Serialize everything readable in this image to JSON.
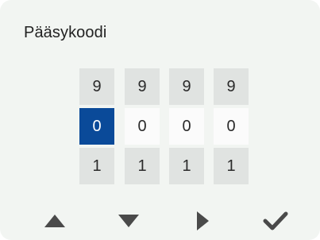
{
  "header": {
    "title": "Pääsykoodi"
  },
  "code": {
    "columns": [
      {
        "prev": "9",
        "current": "0",
        "next": "1",
        "selected": true
      },
      {
        "prev": "9",
        "current": "0",
        "next": "1",
        "selected": false
      },
      {
        "prev": "9",
        "current": "0",
        "next": "1",
        "selected": false
      },
      {
        "prev": "9",
        "current": "0",
        "next": "1",
        "selected": false
      }
    ]
  },
  "nav": {
    "up": "up-arrow-icon",
    "down": "down-arrow-icon",
    "next": "right-arrow-icon",
    "confirm": "checkmark-icon"
  },
  "colors": {
    "selected": "#0a4a99",
    "background": "#f2f5f2",
    "cell": "#e0e3e1",
    "icon": "#4a4a4a"
  }
}
